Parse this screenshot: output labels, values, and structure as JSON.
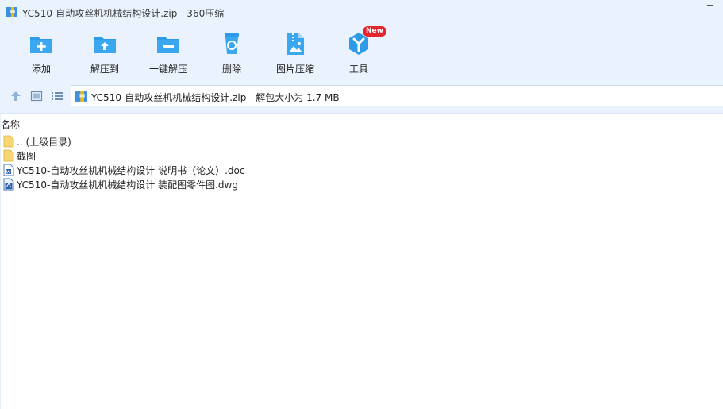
{
  "window": {
    "title": "YC510-自动攻丝机机械结构设计.zip - 360压缩"
  },
  "toolbar": {
    "items": [
      {
        "label": "添加",
        "icon": "add-folder-icon"
      },
      {
        "label": "解压到",
        "icon": "extract-to-icon"
      },
      {
        "label": "一键解压",
        "icon": "one-click-extract-icon"
      },
      {
        "label": "删除",
        "icon": "recycle-bin-icon"
      },
      {
        "label": "图片压缩",
        "icon": "image-compress-icon"
      },
      {
        "label": "工具",
        "icon": "tools-icon",
        "badge": "New"
      }
    ]
  },
  "address": {
    "text": "YC510-自动攻丝机机械结构设计.zip - 解包大小为 1.7 MB"
  },
  "list": {
    "column_name": "名称",
    "files": [
      {
        "name": ".. (上级目录)",
        "icon": "folder-icon"
      },
      {
        "name": "截图",
        "icon": "folder-icon"
      },
      {
        "name": "YC510-自动攻丝机机械结构设计 说明书（论文）.doc",
        "icon": "word-doc-icon"
      },
      {
        "name": "YC510-自动攻丝机机械结构设计 装配图零件图.dwg",
        "icon": "dwg-file-icon"
      }
    ]
  },
  "colors": {
    "toolbar_bg": "#eaf3fd",
    "icon_blue": "#2d9be8",
    "badge_red": "#e4252d"
  }
}
